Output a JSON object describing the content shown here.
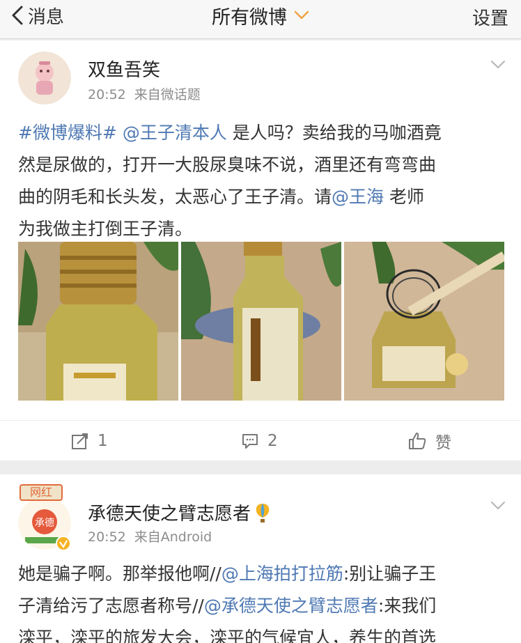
{
  "nav": {
    "back_label": "消息",
    "title": "所有微博",
    "settings_label": "设置"
  },
  "post1": {
    "username": "双鱼吾笑",
    "time": "20:52",
    "source": "来自微话题",
    "lines": [
      [
        {
          "t": "#微博爆料# @王子清本人",
          "link": true
        },
        {
          "t": " 是人吗？卖给我的马咖酒竟",
          "link": false
        }
      ],
      [
        {
          "t": "然是尿做的，打开一大股尿臭味不说，酒里还有弯弯曲",
          "link": false
        }
      ],
      [
        {
          "t": "曲的阴毛和长头发，太恶心了王子清。请",
          "link": false
        },
        {
          "t": "@王海",
          "link": true
        },
        {
          "t": " 老师",
          "link": false
        }
      ],
      [
        {
          "t": "为我做主打倒王子清。",
          "link": false
        }
      ]
    ],
    "repost_count": "1",
    "comment_count": "2",
    "like_label": "赞"
  },
  "post2": {
    "username": "承德天使之臂志愿者",
    "badge_text": "网红",
    "avatar_text": "承德",
    "time": "20:52",
    "source": "来自Android",
    "lines": [
      [
        {
          "t": "她是骗子啊。那举报他啊//",
          "link": false
        },
        {
          "t": "@上海拍打拉筋",
          "link": true
        },
        {
          "t": ":别让骗子王",
          "link": false
        }
      ],
      [
        {
          "t": "子清给污了志愿者称号//",
          "link": false
        },
        {
          "t": "@承德天使之臂志愿者",
          "link": true
        },
        {
          "t": ":来我们",
          "link": false
        }
      ],
      [
        {
          "t": "滦平，滦平的旅发大会，滦平的气候宜人，养生的首选",
          "link": false
        }
      ]
    ]
  },
  "colors": {
    "link": "#4f79b3",
    "nav_bg": "#f7f7f7",
    "page_bg": "#ededed",
    "chevron": "#f0a040"
  },
  "icons": [
    "back-chevron-icon",
    "dropdown-chevron-icon",
    "expand-chevron-icon",
    "repost-icon",
    "comment-icon",
    "like-icon",
    "hot-air-balloon-icon",
    "verified-v-icon"
  ]
}
